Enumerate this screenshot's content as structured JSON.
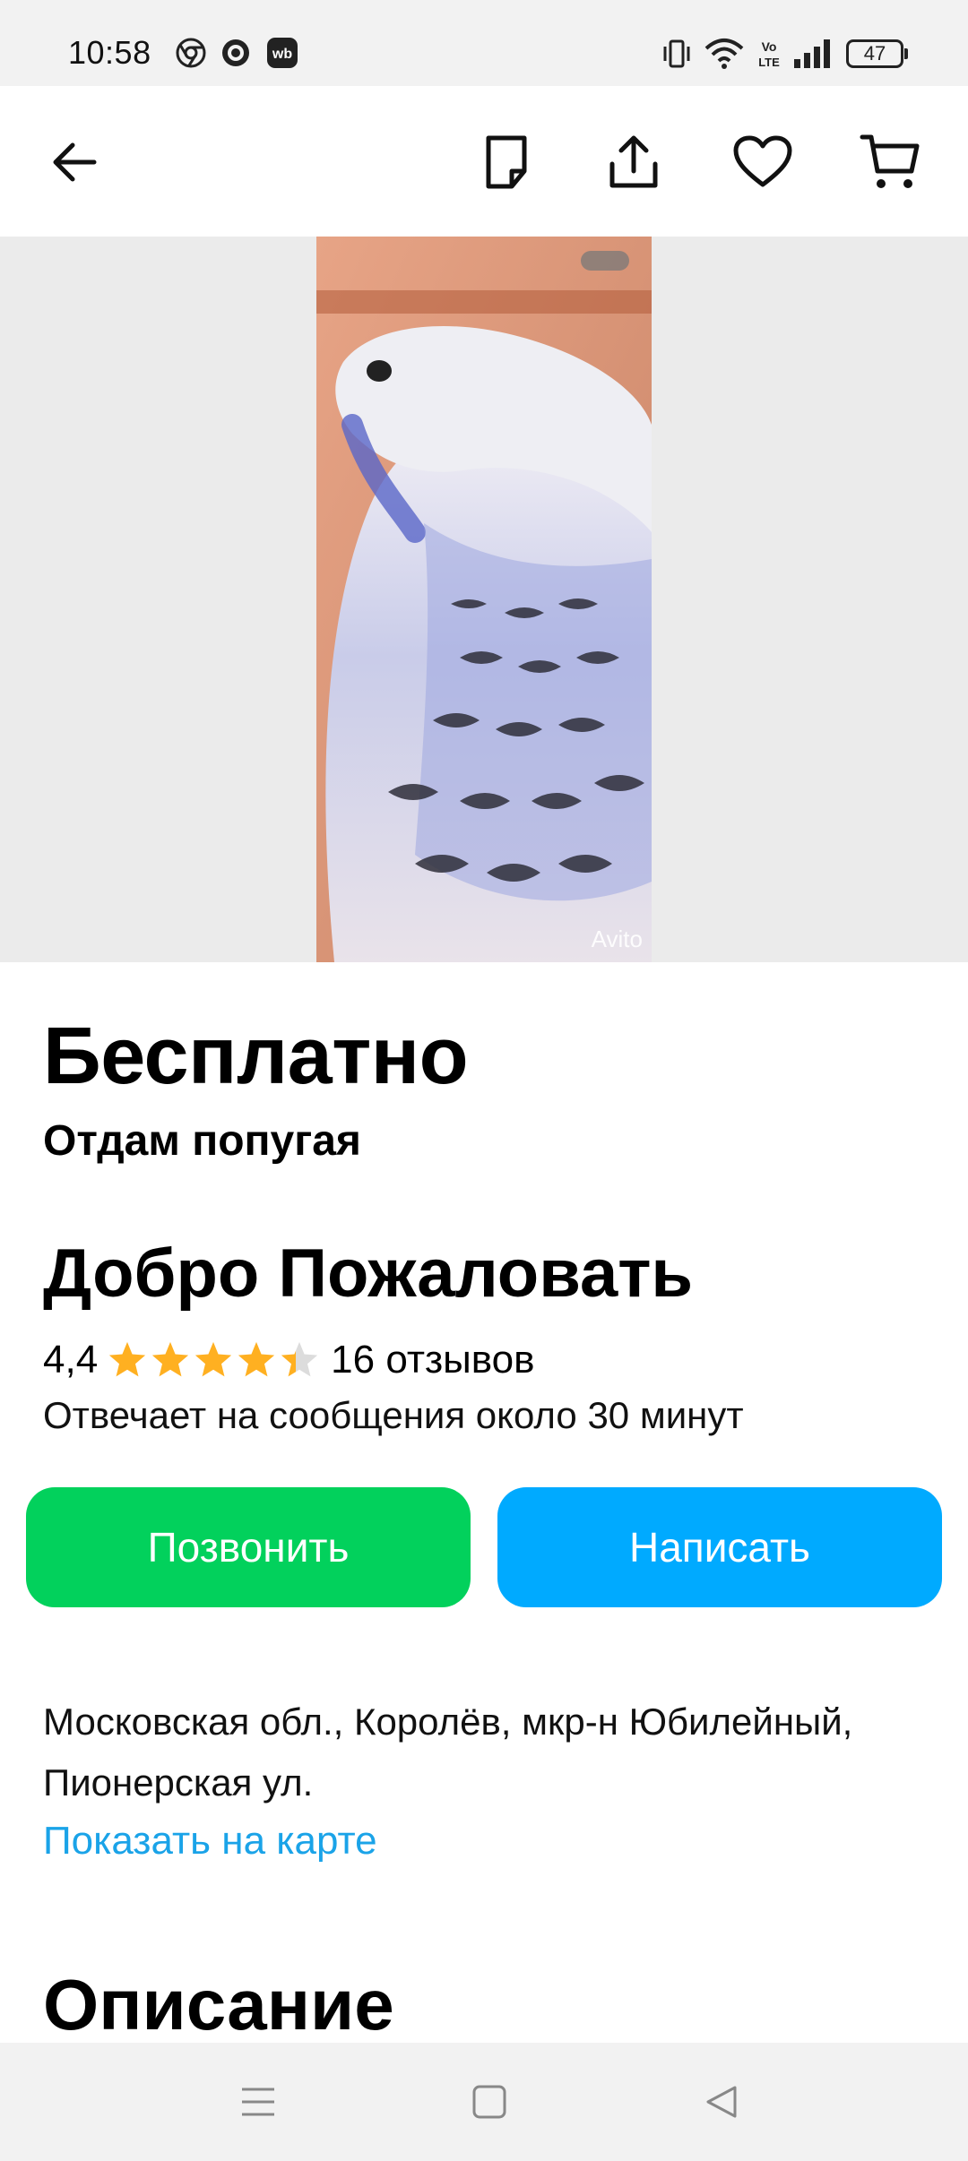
{
  "status_bar": {
    "time": "10:58",
    "battery": "47",
    "network": "LTE"
  },
  "toolbar": {
    "icons": [
      "back-arrow-icon",
      "notes-icon",
      "share-icon",
      "favorite-heart-icon",
      "cart-icon"
    ]
  },
  "gallery": {
    "watermark": "Avito"
  },
  "listing": {
    "price": "Бесплатно",
    "title": "Отдам попугая"
  },
  "seller": {
    "name": "Добро Пожаловать",
    "rating": "4,4",
    "rating_value": 4.4,
    "rating_max": 5,
    "reviews": "16 отзывов",
    "reply_time": "Отвечает на сообщения около 30 минут"
  },
  "actions": {
    "call_label": "Позвонить",
    "write_label": "Написать",
    "call_color": "#02d15c",
    "write_color": "#00aaff"
  },
  "location": {
    "address": "Московская обл., Королёв, мкр-н Юбилейный, Пионерская ул.",
    "map_link": "Показать на карте"
  },
  "description": {
    "heading": "Описание"
  },
  "colors": {
    "star": "#ffb021",
    "link": "#1aa3e8"
  }
}
